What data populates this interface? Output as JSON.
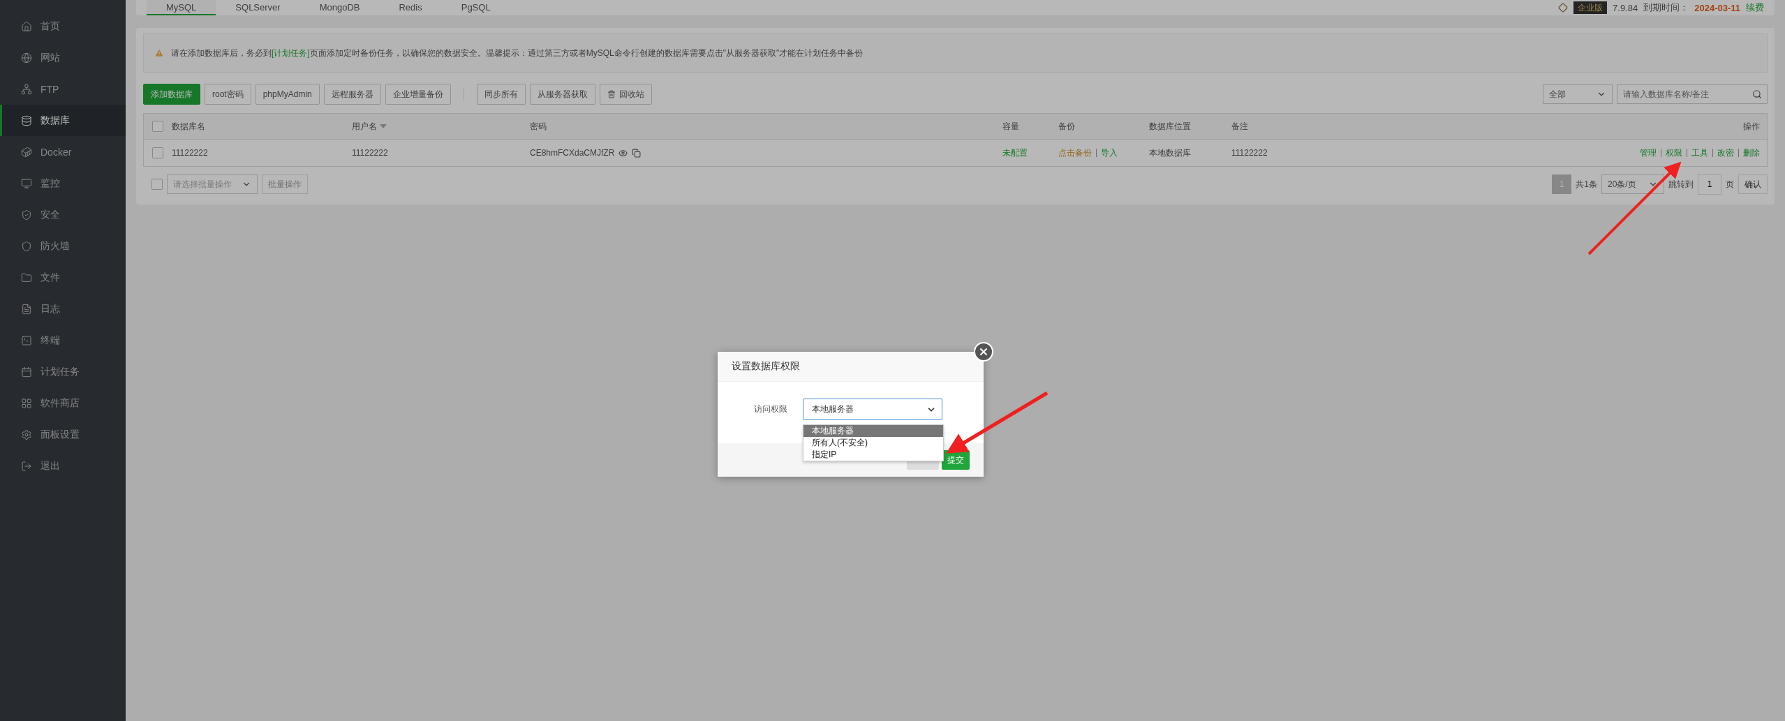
{
  "sidebar": {
    "items": [
      {
        "label": "首页",
        "selected": false
      },
      {
        "label": "网站",
        "selected": false
      },
      {
        "label": "FTP",
        "selected": false
      },
      {
        "label": "数据库",
        "selected": true
      },
      {
        "label": "Docker",
        "selected": false
      },
      {
        "label": "监控",
        "selected": false
      },
      {
        "label": "安全",
        "selected": false
      },
      {
        "label": "防火墙",
        "selected": false
      },
      {
        "label": "文件",
        "selected": false
      },
      {
        "label": "日志",
        "selected": false
      },
      {
        "label": "终端",
        "selected": false
      },
      {
        "label": "计划任务",
        "selected": false
      },
      {
        "label": "软件商店",
        "selected": false
      },
      {
        "label": "面板设置",
        "selected": false
      },
      {
        "label": "退出",
        "selected": false
      }
    ]
  },
  "top_bar": {
    "tabs": [
      {
        "label": "MySQL",
        "selected": true
      },
      {
        "label": "SQLServer",
        "selected": false
      },
      {
        "label": "MongoDB",
        "selected": false
      },
      {
        "label": "Redis",
        "selected": false
      },
      {
        "label": "PgSQL",
        "selected": false
      }
    ],
    "edition": "企业版",
    "version": "7.9.84",
    "expiry_label": "到期时间：",
    "expiry_date": "2024-03-11",
    "renew": "续费"
  },
  "notice": {
    "before": "请在添加数据库后，务必到",
    "link": "[计划任务]",
    "after": "页面添加定时备份任务，以确保您的数据安全。温馨提示：通过第三方或者MySQL命令行创建的数据库需要点击\"从服务器获取\"才能在计划任务中备份"
  },
  "toolbar": {
    "button_groups": [
      [
        {
          "label": "添加数据库",
          "kind": "primary"
        },
        {
          "label": "root密码",
          "kind": "plain"
        },
        {
          "label": "phpMyAdmin",
          "kind": "plain"
        },
        {
          "label": "远程服务器",
          "kind": "plain"
        },
        {
          "label": "企业增量备份",
          "kind": "plain"
        }
      ],
      [
        {
          "label": "同步所有",
          "kind": "plain"
        },
        {
          "label": "从服务器获取",
          "kind": "plain"
        },
        {
          "label": "回收站",
          "kind": "recycle"
        }
      ]
    ],
    "filter": "全部",
    "search_placeholder": "请输入数据库名称/备注"
  },
  "table": {
    "select_all_checked": false,
    "columns": [
      {
        "label": "数据库名",
        "sortable": false
      },
      {
        "label": "用户名",
        "sortable": true
      },
      {
        "label": "密码",
        "sortable": false
      },
      {
        "label": "容量",
        "sortable": false
      },
      {
        "label": "备份",
        "sortable": false
      },
      {
        "label": "数据库位置",
        "sortable": false
      },
      {
        "label": "备注",
        "sortable": false
      },
      {
        "label": "操作",
        "sortable": false
      }
    ],
    "rows": [
      {
        "checked": false,
        "name": "11122222",
        "user": "11122222",
        "password": "CE8hmFCXdaCMJfZR",
        "capacity": "未配置",
        "backup": "点击备份",
        "import": "导入",
        "location": "本地数据库",
        "note": "11122222",
        "actions": [
          "管理",
          "权限",
          "工具",
          "改密",
          "删除"
        ]
      }
    ]
  },
  "footer": {
    "batch_checked": false,
    "batch_placeholder": "请选择批量操作",
    "batch_button": "批量操作",
    "pagination": {
      "pages": [
        {
          "label": "1",
          "selected": true
        }
      ],
      "total": "共1条",
      "page_size": "20条/页",
      "jump_label": "跳转到",
      "jump_value": "1",
      "page_unit": "页",
      "confirm": "确认"
    }
  },
  "dialog": {
    "title": "设置数据库权限",
    "field_label": "访问权限",
    "value": "本地服务器",
    "options": [
      {
        "label": "本地服务器",
        "selected": true
      },
      {
        "label": "所有人(不安全)",
        "selected": false
      },
      {
        "label": "指定IP",
        "selected": false
      }
    ],
    "submit": "提交"
  }
}
